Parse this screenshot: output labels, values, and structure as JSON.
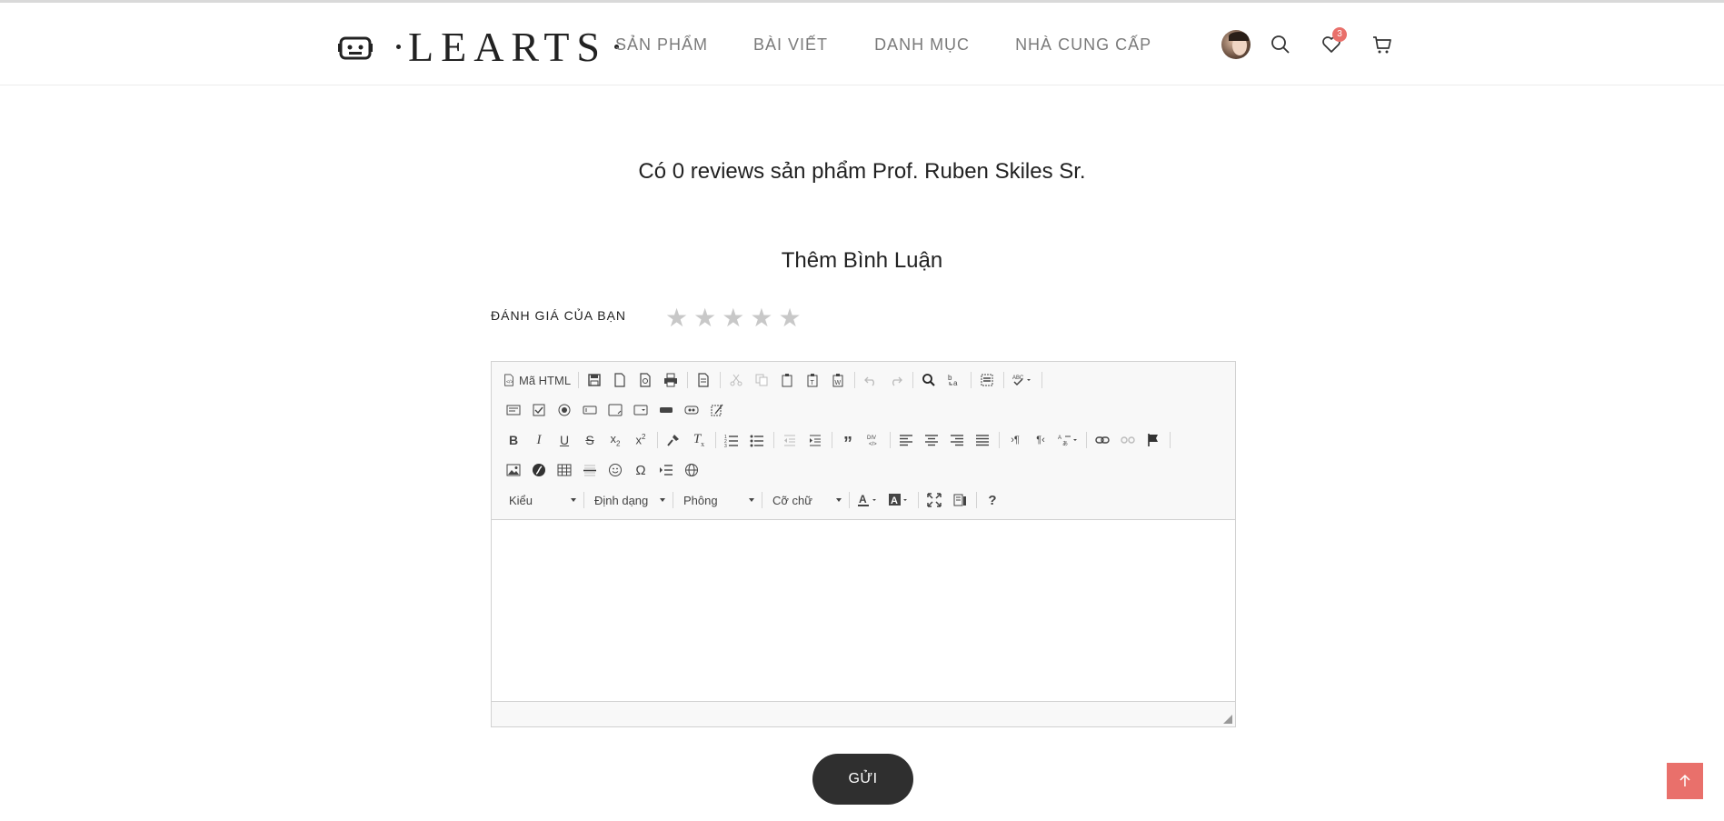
{
  "header": {
    "logo_text": "LEARTS",
    "nav": [
      "SẢN PHẨM",
      "BÀI VIẾT",
      "DANH MỤC",
      "NHÀ CUNG CẤP"
    ],
    "wishlist_count": "3",
    "icons": [
      "avatar",
      "search-icon",
      "heart-icon",
      "cart-icon"
    ]
  },
  "reviews": {
    "summary": "Có 0 reviews sản phẩm Prof. Ruben Skiles Sr."
  },
  "comment_form": {
    "title": "Thêm Bình Luận",
    "rating_label": "ĐÁNH GIÁ CỦA BẠN",
    "rating_value": 0,
    "rating_max": 5,
    "editor": {
      "source_label": "Mã HTML",
      "combos": [
        "Kiểu",
        "Định dạng",
        "Phông",
        "Cỡ chữ"
      ],
      "content": ""
    },
    "submit_label": "GỬI"
  },
  "colors": {
    "accent": "#e9706b",
    "button_dark": "#2f2f2f",
    "star_empty": "#c8c8c8"
  }
}
